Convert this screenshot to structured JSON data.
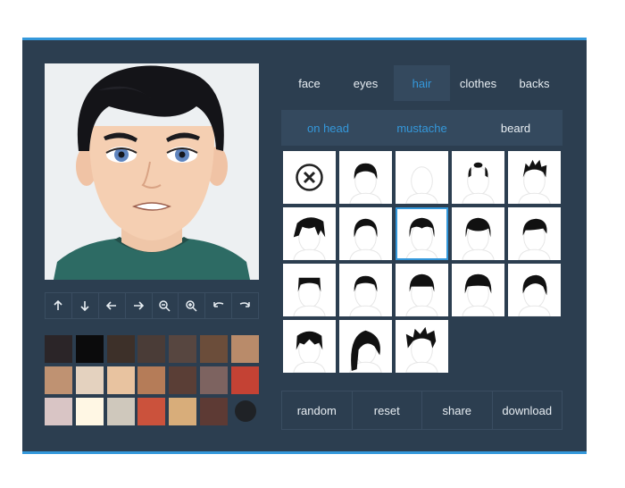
{
  "tabs": [
    {
      "label": "face",
      "active": false
    },
    {
      "label": "eyes",
      "active": false
    },
    {
      "label": "hair",
      "active": true
    },
    {
      "label": "clothes",
      "active": false
    },
    {
      "label": "backs",
      "active": false
    }
  ],
  "subtabs": [
    {
      "label": "on head",
      "active": true
    },
    {
      "label": "mustache",
      "active": false
    },
    {
      "label": "beard",
      "active": false
    }
  ],
  "tools": [
    "arrow-up-icon",
    "arrow-down-icon",
    "arrow-left-icon",
    "arrow-right-icon",
    "zoom-out-icon",
    "zoom-in-icon",
    "undo-icon",
    "redo-icon"
  ],
  "palette": [
    "#2b2528",
    "#0b0b0c",
    "#3d3029",
    "#4a3c37",
    "#574640",
    "#6b4d3a",
    "#b98b6a",
    "#bf9272",
    "#e4d2bf",
    "#e8c3a0",
    "#b57c58",
    "#5a3e36",
    "#7d6360",
    "#c44234",
    "#d9c5c5",
    "#fff7e4",
    "#cfc8bc",
    "#cb523c",
    "#d8ad7a",
    "#5d3a34",
    "#1f2226"
  ],
  "hair_styles": [
    "none",
    "short-slick",
    "bald",
    "bald-top",
    "spiky-short",
    "messy",
    "side-part",
    "middle-part",
    "helmet",
    "swept",
    "flat-top",
    "short-crop",
    "bowl",
    "straight-bangs",
    "side-swept",
    "tousled",
    "long-emo",
    "spiky-wild"
  ],
  "selected_hair_index": 7,
  "actions": [
    "random",
    "reset",
    "share",
    "download"
  ],
  "colors": {
    "accent": "#3498db",
    "panel": "#2c3e50"
  }
}
